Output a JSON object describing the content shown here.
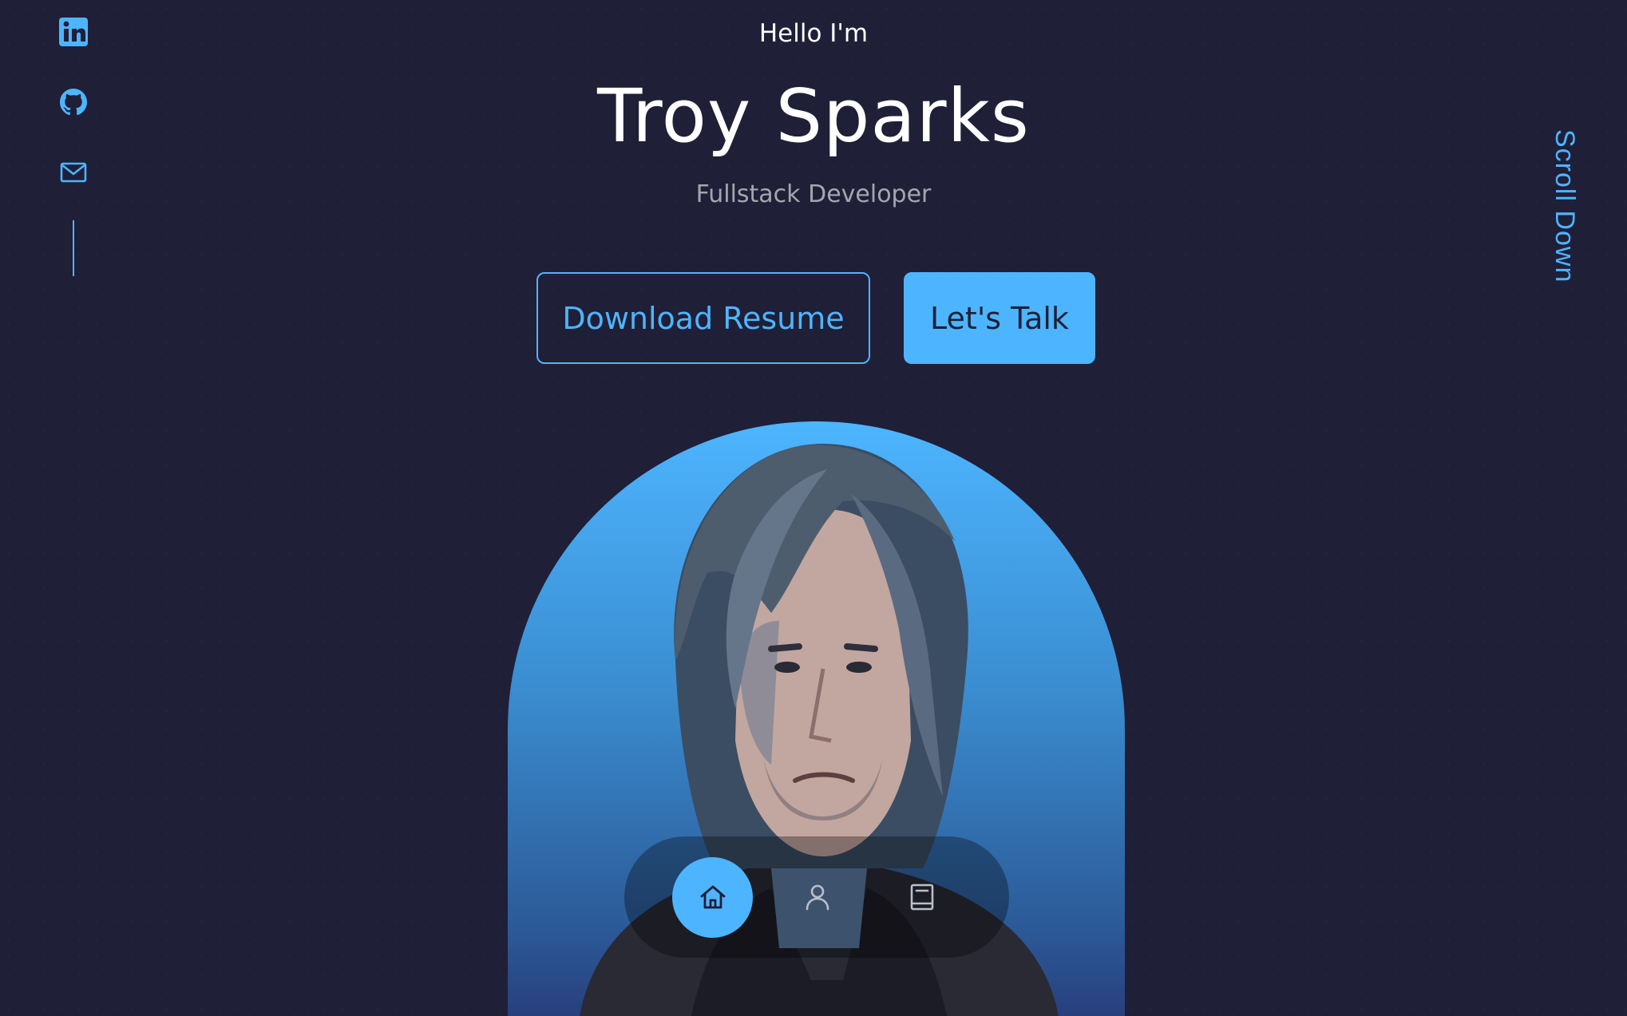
{
  "header": {
    "greeting": "Hello I'm",
    "name": "Troy Sparks",
    "role": "Fullstack Developer"
  },
  "cta": {
    "download_label": "Download Resume",
    "talk_label": "Let's Talk"
  },
  "scroll": {
    "label": "Scroll Down"
  },
  "socials": [
    {
      "icon": "linkedin-icon"
    },
    {
      "icon": "github-icon"
    },
    {
      "icon": "mail-icon"
    }
  ],
  "nav": [
    {
      "icon": "home-icon",
      "active": true
    },
    {
      "icon": "user-icon",
      "active": false
    },
    {
      "icon": "book-icon",
      "active": false
    }
  ],
  "colors": {
    "background": "#1f1f38",
    "accent": "#4db5ff",
    "text": "#ffffff",
    "muted_text": "#9a9aae"
  }
}
